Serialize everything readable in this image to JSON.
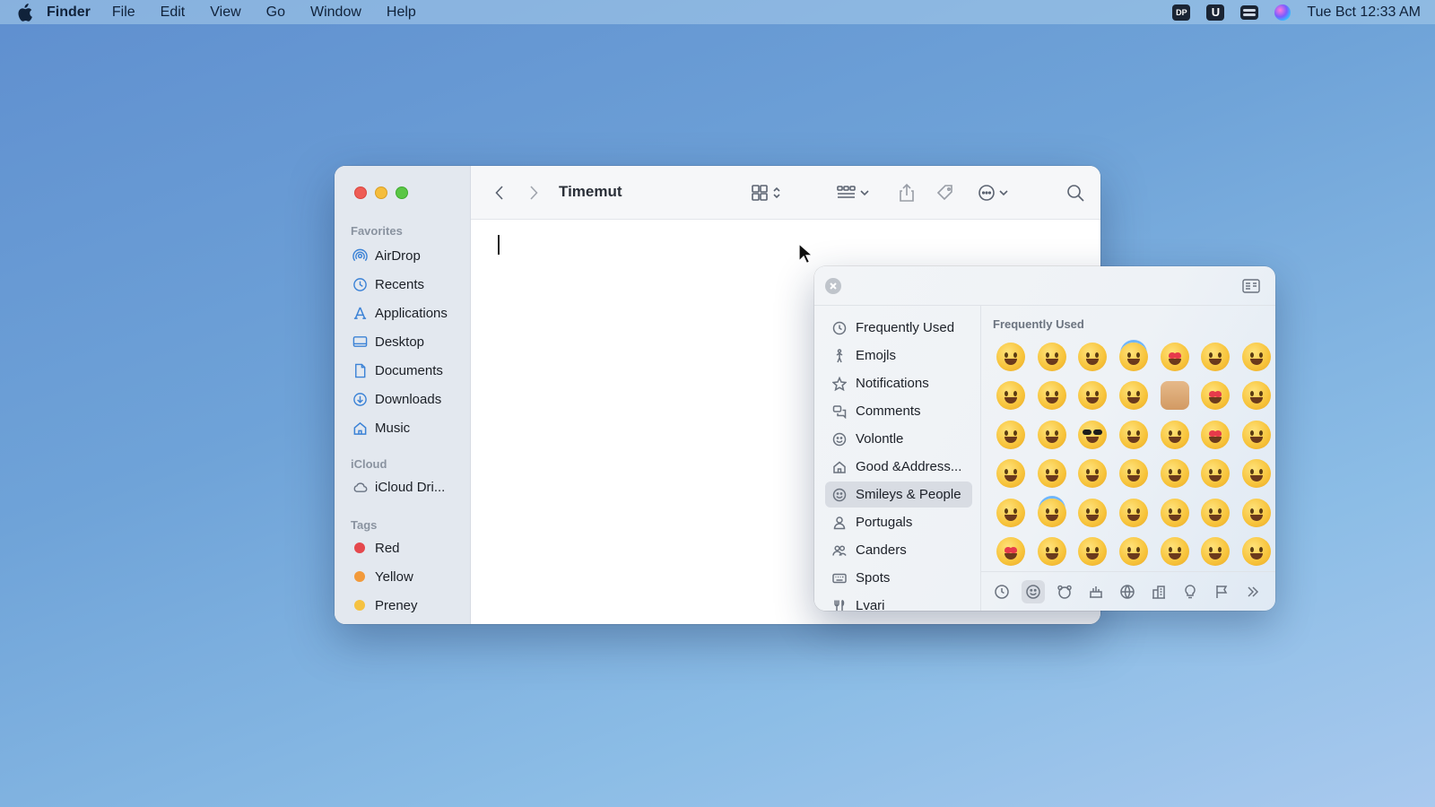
{
  "menubar": {
    "app_name": "Finder",
    "menus": [
      "File",
      "Edit",
      "View",
      "Go",
      "Window",
      "Help"
    ],
    "status_badge_text": "DP",
    "user_badge_text": "U",
    "clock": "Tue Bct  12:33 AM"
  },
  "finder": {
    "title": "Timemut",
    "sidebar": {
      "favorites_title": "Favorites",
      "favorites": [
        "AirDrop",
        "Recents",
        "Applications",
        "Desktop",
        "Documents",
        "Downloads",
        "Music"
      ],
      "icloud_title": "iCloud",
      "icloud_items": [
        "iCloud Dri..."
      ],
      "tags_title": "Tags",
      "tags": [
        {
          "label": "Red",
          "color": "#e5484d"
        },
        {
          "label": "Yellow",
          "color": "#f29a3b"
        },
        {
          "label": "Preney",
          "color": "#f5c242"
        }
      ]
    }
  },
  "emoji_picker": {
    "section_title": "Frequently Used",
    "categories": [
      "Frequently Used",
      "Emojls",
      "Notifications",
      "Comments",
      "Volontle",
      "Good &Address...",
      "Smileys & People",
      "Portugals",
      "Canders",
      "Spots",
      "Lvari"
    ],
    "selected_category": "Smileys & People",
    "bottom_tabs": [
      "clock-icon",
      "smiley-icon",
      "bear-icon",
      "food-icon",
      "globe-icon",
      "building-icon",
      "lightbulb-icon",
      "flag-icon",
      "chevron-double-right-icon"
    ],
    "active_bottom_tab": "smiley-icon"
  }
}
